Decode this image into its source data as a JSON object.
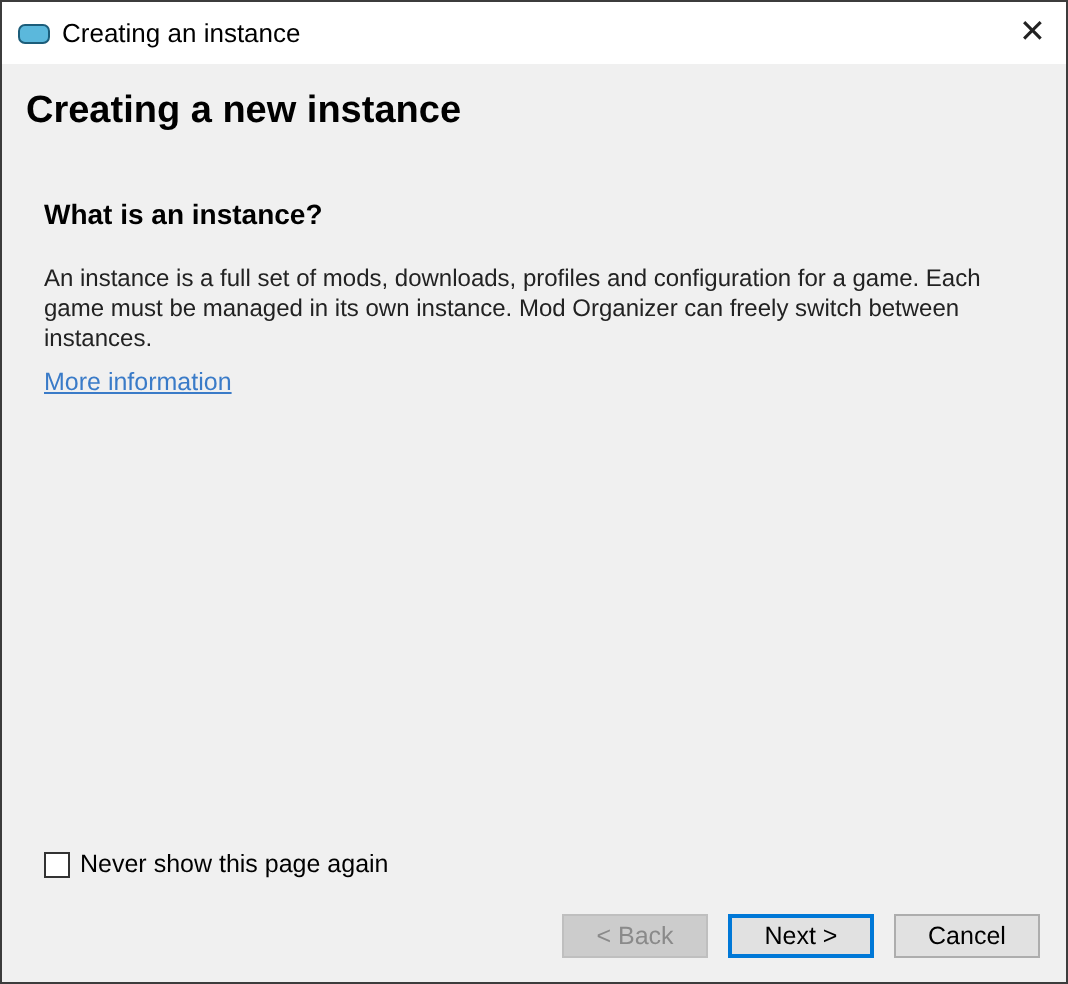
{
  "window": {
    "title": "Creating an instance",
    "close": "✕"
  },
  "page_title": "Creating a new instance",
  "section": {
    "heading": "What is an instance?",
    "body": "An instance is a full set of mods, downloads, profiles and configuration for a game. Each game must be managed in its own instance. Mod Organizer can freely switch between instances.",
    "link": "More information"
  },
  "never_show": {
    "label": "Never show this page again",
    "checked": false
  },
  "buttons": [
    {
      "label": "< Back",
      "disabled": true,
      "default": false
    },
    {
      "label": "Next >",
      "disabled": false,
      "default": true
    },
    {
      "label": "Cancel",
      "disabled": false,
      "default": false
    }
  ]
}
